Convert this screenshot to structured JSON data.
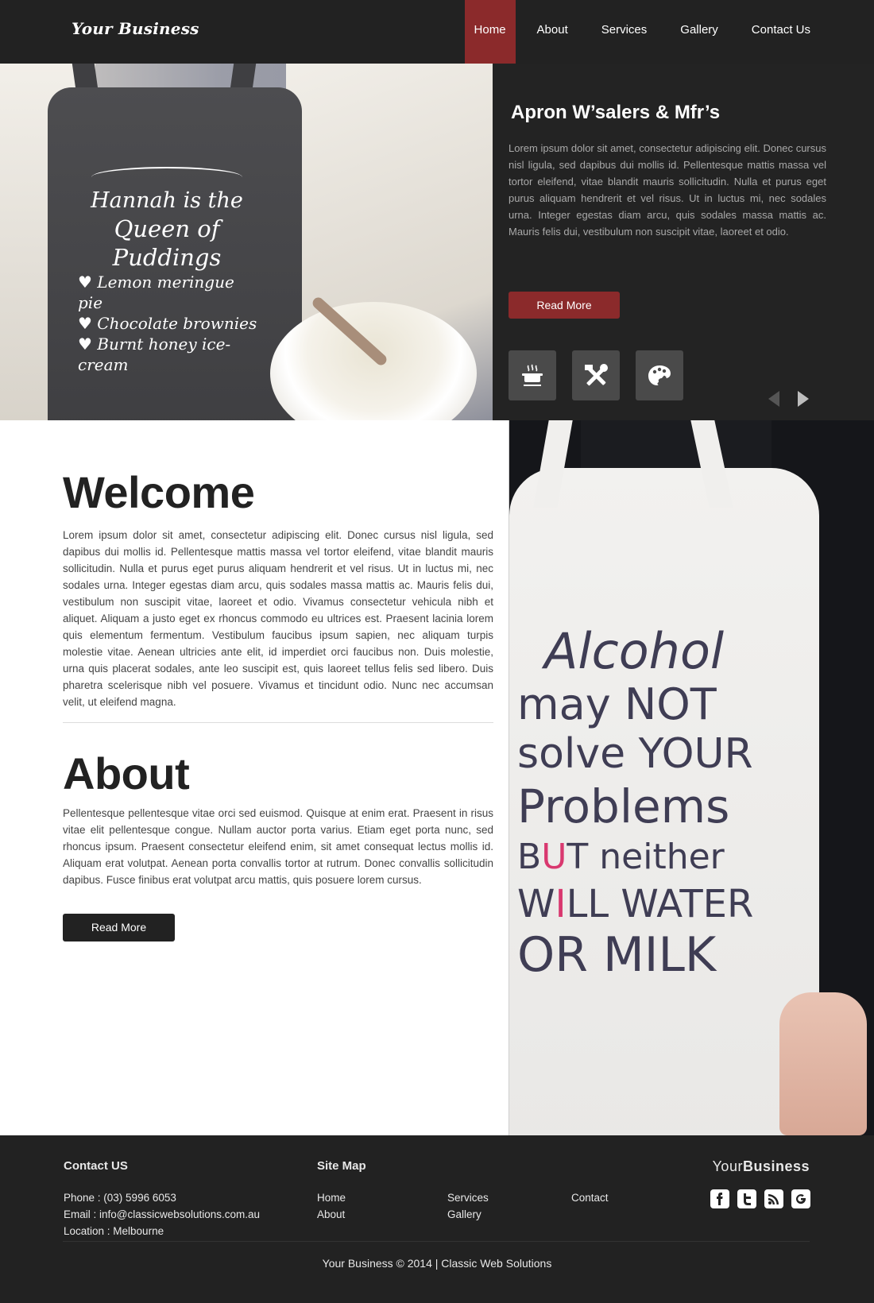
{
  "header": {
    "logo": "Your Business",
    "nav": [
      "Home",
      "About",
      "Services",
      "Gallery",
      "Contact Us"
    ],
    "active": "Home"
  },
  "hero": {
    "apron_text": {
      "line1": "Hannah is the",
      "line2": "Queen of Puddings",
      "items": [
        "♥ Lemon meringue pie",
        "♥ Chocolate brownies",
        "♥ Burnt honey ice-cream"
      ]
    },
    "title": "Apron W’salers & Mfr’s",
    "text": "Lorem ipsum dolor sit amet, consectetur adipiscing elit. Donec cursus nisl ligula, sed dapibus dui mollis id. Pellentesque mattis massa vel tortor eleifend, vitae blandit mauris sollicitudin. Nulla et purus eget purus aliquam hendrerit et vel risus. Ut in luctus mi, nec sodales urna. Integer egestas diam arcu, quis sodales massa mattis ac. Mauris felis dui, vestibulum non suscipit vitae, laoreet et odio.",
    "button": "Read More",
    "icons": [
      "cooking-pot-icon",
      "tools-icon",
      "palette-icon"
    ],
    "colors": {
      "accent": "#8b2a2b",
      "panel": "#232323"
    }
  },
  "main": {
    "welcome_title": "Welcome",
    "welcome_text": "Lorem ipsum dolor sit amet, consectetur adipiscing elit. Donec cursus nisl ligula, sed dapibus dui mollis id. Pellentesque mattis massa vel tortor eleifend, vitae blandit mauris sollicitudin. Nulla et purus eget purus aliquam hendrerit et vel risus. Ut in luctus mi, nec sodales urna. Integer egestas diam arcu, quis sodales massa mattis ac. Mauris felis dui, vestibulum non suscipit vitae, laoreet et odio. Vivamus consectetur vehicula nibh et aliquet. Aliquam a justo eget ex rhoncus commodo eu ultrices est. Praesent lacinia lorem quis elementum fermentum. Vestibulum faucibus ipsum sapien, nec aliquam turpis molestie vitae. Aenean ultricies ante elit, id imperdiet orci faucibus non. Duis molestie, urna quis placerat sodales, ante leo suscipit est, quis laoreet tellus felis sed libero. Duis pharetra scelerisque nibh vel posuere. Vivamus et tincidunt odio. Nunc nec accumsan velit, ut eleifend magna.",
    "about_title": "About",
    "about_text": "Pellentesque pellentesque vitae orci sed euismod. Quisque at enim erat. Praesent in risus vitae elit pellentesque congue. Nullam auctor porta varius. Etiam eget porta nunc, sed rhoncus ipsum. Praesent consectetur eleifend enim, sit amet consequat lectus mollis id. Aliquam erat volutpat. Aenean porta convallis tortor at rutrum. Donec convallis sollicitudin dapibus. Fusce finibus erat volutpat arcu mattis, quis posuere lorem cursus.",
    "button": "Read More",
    "apron2_text": {
      "l1": "Alcohol",
      "l2": "may NOT",
      "l3": "solve YOUR",
      "l4": "Problems",
      "l5a": "B",
      "l5b": "T neither",
      "l6a": "W",
      "l6b": "LL WATER",
      "l7": "OR MILK"
    }
  },
  "footer": {
    "contact_title": "Contact US",
    "phone": "Phone : (03) 5996 6053",
    "email": "Email : info@classicwebsolutions.com.au",
    "location": "Location : Melbourne",
    "sitemap_title": "Site Map",
    "links": [
      "Home",
      "About",
      "Services",
      "Gallery",
      "Contact"
    ],
    "brand_light": "Your",
    "brand_bold": "Business",
    "social": [
      "facebook-icon",
      "twitter-icon",
      "rss-icon",
      "google-icon"
    ],
    "copyright": "Your Business © 2014  |  Classic Web Solutions"
  }
}
